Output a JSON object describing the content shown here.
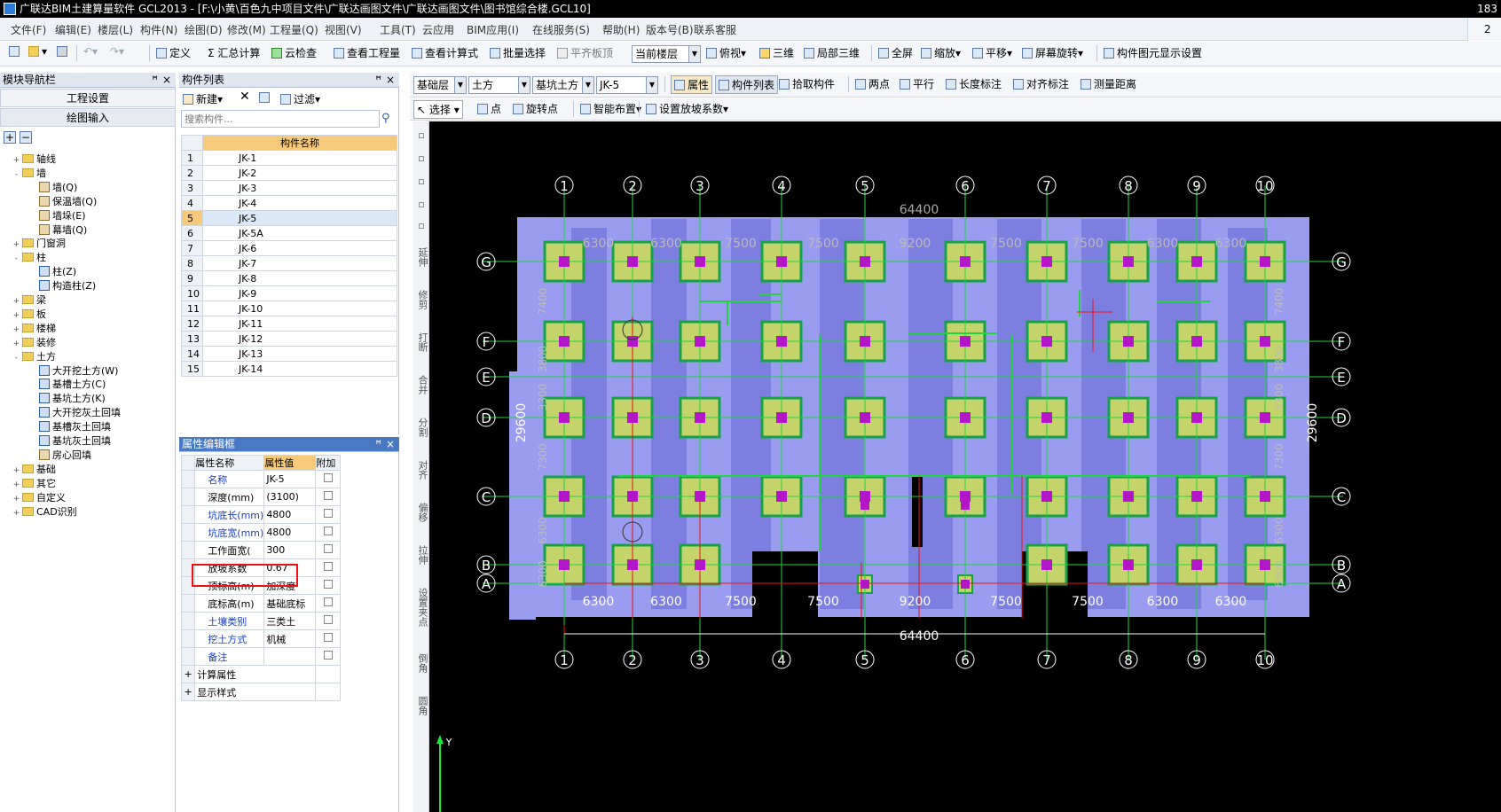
{
  "window": {
    "title": "广联达BIM土建算量软件 GCL2013 - [F:\\小黄\\百色九中项目文件\\广联达画图文件\\广联达画图文件\\图书馆综合楼.GCL10]",
    "right_text": "183"
  },
  "menubar": {
    "items": [
      "文件(F)",
      "编辑(E)",
      "楼层(L)",
      "构件(N)",
      "绘图(D)",
      "修改(M)",
      "工程量(Q)",
      "视图(V)",
      "工具(T)",
      "云应用",
      "BIM应用(I)",
      "在线服务(S)",
      "帮助(H)",
      "版本号(B)",
      "联系客服"
    ],
    "badge": "2"
  },
  "toolbar1": {
    "define": "定义",
    "sum": "汇总计算",
    "cloud_check": "云检查",
    "view_quantity": "查看工程量",
    "view_formula": "查看计算式",
    "batch_select": "批量选择",
    "flat_slab": "平齐板顶",
    "floor_label": "当前楼层",
    "view_mode": "俯视",
    "three_d": "三维",
    "local_3d": "局部三维",
    "full_screen": "全屏",
    "zoom": "缩放",
    "pan": "平移",
    "rotate": "屏幕旋转",
    "element_display": "构件图元显示设置"
  },
  "toolbar2": {
    "floor": "基础层",
    "type": "土方",
    "subtype": "基坑土方",
    "element": "JK-5",
    "attribute": "属性",
    "element_list": "构件列表",
    "pick": "拾取构件",
    "two_points": "两点",
    "parallel": "平行",
    "length_note": "长度标注",
    "align_note": "对齐标注",
    "measure": "测量距离"
  },
  "toolbar3": {
    "select": "选择",
    "point": "点",
    "rotate_point": "旋转点",
    "smart_layout": "智能布置",
    "slope_setting": "设置放坡系数"
  },
  "nav_panel": {
    "title": "模块导航栏",
    "project_settings": "工程设置",
    "drawing_input": "绘图输入",
    "tree": [
      {
        "level": 0,
        "type": "folder",
        "expander": "+",
        "label": "轴线"
      },
      {
        "level": 0,
        "type": "folder",
        "expander": "-",
        "label": "墙"
      },
      {
        "level": 1,
        "type": "leaf",
        "label": "墙(Q)"
      },
      {
        "level": 1,
        "type": "leaf",
        "label": "保温墙(Q)"
      },
      {
        "level": 1,
        "type": "leaf",
        "label": "墙垛(E)"
      },
      {
        "level": 1,
        "type": "leaf",
        "label": "幕墙(Q)"
      },
      {
        "level": 0,
        "type": "folder",
        "expander": "+",
        "label": "门窗洞"
      },
      {
        "level": 0,
        "type": "folder",
        "expander": "-",
        "label": "柱"
      },
      {
        "level": 1,
        "type": "leafb",
        "label": "柱(Z)"
      },
      {
        "level": 1,
        "type": "leafb",
        "label": "构造柱(Z)"
      },
      {
        "level": 0,
        "type": "folder",
        "expander": "+",
        "label": "梁"
      },
      {
        "level": 0,
        "type": "folder",
        "expander": "+",
        "label": "板"
      },
      {
        "level": 0,
        "type": "folder",
        "expander": "+",
        "label": "楼梯"
      },
      {
        "level": 0,
        "type": "folder",
        "expander": "+",
        "label": "装修"
      },
      {
        "level": 0,
        "type": "folder",
        "expander": "-",
        "label": "土方"
      },
      {
        "level": 1,
        "type": "leafb",
        "label": "大开挖土方(W)"
      },
      {
        "level": 1,
        "type": "leafb",
        "label": "基槽土方(C)"
      },
      {
        "level": 1,
        "type": "leafb",
        "label": "基坑土方(K)"
      },
      {
        "level": 1,
        "type": "leafb",
        "label": "大开挖灰土回填"
      },
      {
        "level": 1,
        "type": "leafb",
        "label": "基槽灰土回填"
      },
      {
        "level": 1,
        "type": "leafb",
        "label": "基坑灰土回填"
      },
      {
        "level": 1,
        "type": "leaf",
        "label": "房心回填"
      },
      {
        "level": 0,
        "type": "folder",
        "expander": "+",
        "label": "基础"
      },
      {
        "level": 0,
        "type": "folder",
        "expander": "+",
        "label": "其它"
      },
      {
        "level": 0,
        "type": "folder",
        "expander": "+",
        "label": "自定义"
      },
      {
        "level": 0,
        "type": "folder",
        "expander": "+",
        "label": "CAD识别"
      }
    ]
  },
  "component_list": {
    "title": "构件列表",
    "new_label": "新建",
    "filter_label": "过滤",
    "search_placeholder": "搜索构件...",
    "column_header": "构件名称",
    "rows": [
      "JK-1",
      "JK-2",
      "JK-3",
      "JK-4",
      "JK-5",
      "JK-5A",
      "JK-6",
      "JK-7",
      "JK-8",
      "JK-9",
      "JK-10",
      "JK-11",
      "JK-12",
      "JK-13",
      "JK-14"
    ],
    "selected_index": 4
  },
  "property_editor": {
    "title": "属性编辑框",
    "headers": [
      "属性名称",
      "属性值",
      "附加"
    ],
    "rows": [
      {
        "name": "名称",
        "value": "JK-5",
        "blue": true
      },
      {
        "name": "深度(mm)",
        "value": "(3100)",
        "blue": false
      },
      {
        "name": "坑底长(mm)",
        "value": "4800",
        "blue": true
      },
      {
        "name": "坑底宽(mm)",
        "value": "4800",
        "blue": true
      },
      {
        "name": "工作面宽(",
        "value": "300",
        "blue": false
      },
      {
        "name": "放坡系数",
        "value": "0.67",
        "blue": false
      },
      {
        "name": "顶标高(m)",
        "value": "加深度",
        "blue": false
      },
      {
        "name": "底标高(m)",
        "value": "基础底标",
        "blue": false
      },
      {
        "name": "土壤类别",
        "value": "三类土",
        "blue": true
      },
      {
        "name": "挖土方式",
        "value": "机械",
        "blue": true
      },
      {
        "name": "备注",
        "value": "",
        "blue": true
      }
    ],
    "groups": [
      "计算属性",
      "显示样式"
    ]
  },
  "vertical_tools": [
    "延伸",
    "修剪",
    "打断",
    "合并",
    "分割",
    "对齐",
    "偏移",
    "拉伸",
    "设置夹点",
    "倒角",
    "圆角"
  ],
  "drawing": {
    "col_axes": [
      "1",
      "2",
      "3",
      "4",
      "5",
      "6",
      "7",
      "8",
      "9",
      "10"
    ],
    "row_axes": [
      "G",
      "F",
      "E",
      "D",
      "C",
      "B",
      "A"
    ],
    "top_total": "64400",
    "bottom_total": "64400",
    "top_spans": [
      "6300",
      "6300",
      "7500",
      "7500",
      "9200",
      "7500",
      "7500",
      "6300",
      "6300"
    ],
    "bottom_spans": [
      "6300",
      "6300",
      "7500",
      "7500",
      "9200",
      "7500",
      "7500",
      "6300",
      "6300"
    ],
    "left_total": "29600",
    "right_total": "29600",
    "left_spans": [
      "7400",
      "3800",
      "3300",
      "7300",
      "6300",
      "6300"
    ],
    "right_spans": [
      "7400",
      "3800",
      "3300",
      "7300",
      "6300",
      "6300"
    ],
    "colors": {
      "pit": "#9a9cf0",
      "pit_dark": "#6467d2",
      "base": "#c4d36a",
      "base_border": "#17a24a",
      "axis": "#1fd43e",
      "column": "#b316c8",
      "red": "#e11"
    },
    "axis_label": "Y"
  }
}
